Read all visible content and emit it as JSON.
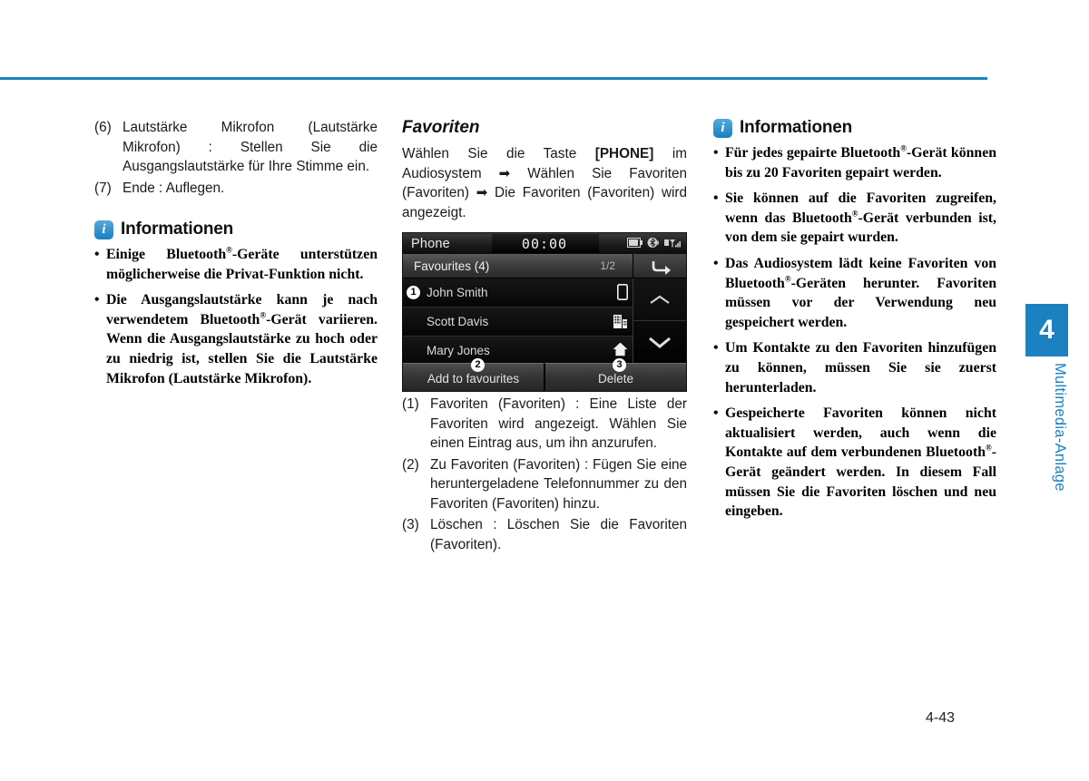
{
  "page": {
    "number": "4-43",
    "accent_color": "#1b81c0",
    "chapter_tab_number": "4",
    "chapter_label": "Multimedia-Anlage"
  },
  "column_left": {
    "numbered_items": [
      {
        "num": "(6)",
        "text": "Lautstärke Mikrofon (Lautstärke Mikrofon) : Stellen Sie die Ausgangslautstärke für Ihre Stimme ein."
      },
      {
        "num": "(7)",
        "text": "Ende : Auflegen."
      }
    ],
    "info_box": {
      "icon": "info-icon",
      "title": "Informationen",
      "bullets": [
        "Einige Bluetooth®-Geräte unterstützen möglicherweise die Privat-Funktion nicht.",
        "Die Ausgangslautstärke kann je nach verwendetem Bluetooth®-Gerät variieren. Wenn die Ausgangslautstärke zu hoch oder zu niedrig ist, stellen Sie die Lautstärke Mikrofon (Lautstärke Mikrofon)."
      ]
    }
  },
  "column_middle": {
    "section_title": "Favoriten",
    "intro_parts": {
      "p1": "Wählen Sie die Taste ",
      "button": "[PHONE]",
      "p2": " im Audiosystem ",
      "arrow1": "➡",
      "p3": " Wählen Sie Favoriten (Favoriten) ",
      "arrow2": "➡",
      "p4": " Die Favoriten (Favoriten) wird angezeigt."
    },
    "device_ui": {
      "status_title": "Phone",
      "clock": "00:00",
      "status_icons": [
        "battery-icon",
        "bluetooth-audio-icon",
        "signal-icon"
      ],
      "sub_header": {
        "label": "Favourites (4)",
        "page_indicator": "1/2",
        "back_button": "back-arrow-icon"
      },
      "rows": [
        {
          "badge": "1",
          "name": "John Smith",
          "icon": "mobile-phone-icon"
        },
        {
          "badge": "",
          "name": "Scott Davis",
          "icon": "office-building-icon"
        },
        {
          "badge": "",
          "name": "Mary Jones",
          "icon": "home-icon"
        }
      ],
      "scroll": {
        "up": "chevron-up-icon",
        "down": "chevron-down-icon"
      },
      "buttons": [
        {
          "label": "Add to favourites",
          "callout": "2"
        },
        {
          "label": "Delete",
          "callout": "3"
        }
      ]
    },
    "numbered_items": [
      {
        "num": "(1)",
        "text": "Favoriten (Favoriten) : Eine Liste der Favoriten wird angezeigt. Wählen Sie einen Eintrag aus, um ihn anzurufen."
      },
      {
        "num": "(2)",
        "text": "Zu Favoriten (Favoriten) : Fügen Sie eine heruntergeladene Telefonnummer zu den Favoriten (Favoriten) hinzu."
      },
      {
        "num": "(3)",
        "text": "Löschen : Löschen Sie die Favoriten (Favoriten)."
      }
    ]
  },
  "column_right": {
    "info_box": {
      "icon": "info-icon",
      "title": "Informationen",
      "bullets": [
        "Für jedes gepairte Bluetooth®-Gerät können bis zu 20 Favoriten gepairt werden.",
        "Sie können auf die Favoriten zugreifen, wenn das Bluetooth®-Gerät verbunden ist, von dem sie gepairt wurden.",
        "Das Audiosystem lädt keine Favoriten von Bluetooth®-Geräten herunter. Favoriten müssen vor der Verwendung neu gespeichert werden.",
        "Um Kontakte zu den Favoriten hinzufügen zu können, müssen Sie sie zuerst herunterladen.",
        "Gespeicherte Favoriten können nicht aktualisiert werden, auch wenn die Kontakte auf dem verbundenen Bluetooth®-Gerät geändert werden. In diesem Fall müssen Sie die Favoriten löschen und neu eingeben."
      ]
    }
  }
}
